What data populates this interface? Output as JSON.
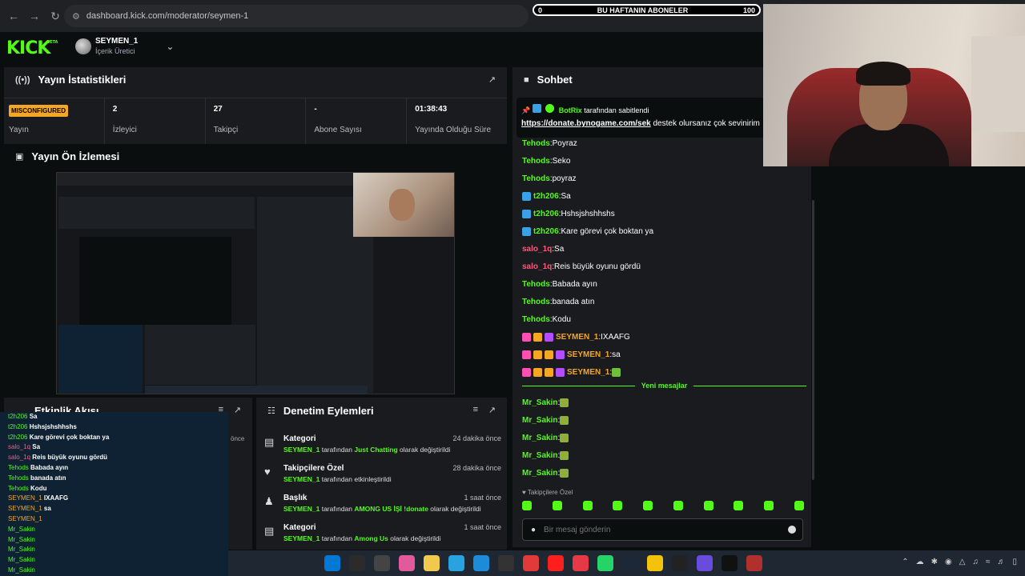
{
  "browser": {
    "url": "dashboard.kick.com/moderator/seymen-1",
    "back_icon": "arrow-left",
    "forward_icon": "arrow-right",
    "reload_icon": "reload"
  },
  "sub_goal": {
    "left": "0",
    "title": "BU HAFTANIN ABONELER",
    "right": "100",
    "progress": 0
  },
  "header": {
    "logo": "KICK",
    "logo_badge": "BETA",
    "user_name": "SEYMEN_1",
    "user_role": "İçerik Üretici"
  },
  "stats": {
    "title": "Yayın İstatistikleri",
    "items": [
      {
        "value": "MISCONFIGURED",
        "label": "Yayın"
      },
      {
        "value": "2",
        "label": "İzleyici"
      },
      {
        "value": "27",
        "label": "Takipçi"
      },
      {
        "value": "-",
        "label": "Abone Sayısı"
      },
      {
        "value": "01:38:43",
        "label": "Yayında Olduğu Süre"
      }
    ]
  },
  "preview": {
    "title": "Yayın Ön İzlemesi"
  },
  "activity": {
    "title": "Etkinlik Akışı",
    "side_text": "önce",
    "lines": [
      {
        "user": "t2h206",
        "text": "Sa",
        "color": "#53fc18"
      },
      {
        "user": "t2h206",
        "text": "Hshsjshshhshs",
        "color": "#53fc18"
      },
      {
        "user": "t2h206",
        "text": "Kare görevi çok boktan ya",
        "color": "#53fc18"
      },
      {
        "user": "salo_1q",
        "text": "Sa",
        "color": "#ff5a7a"
      },
      {
        "user": "salo_1q",
        "text": "Reis büyük oyunu gördü",
        "color": "#ff5a7a"
      },
      {
        "user": "Tehods",
        "text": "Babada ayın",
        "color": "#53fc18"
      },
      {
        "user": "Tehods",
        "text": "banada atın",
        "color": "#53fc18"
      },
      {
        "user": "Tehods",
        "text": "Kodu",
        "color": "#53fc18"
      },
      {
        "user": "SEYMEN_1",
        "text": "IXAAFG",
        "color": "#f5a623"
      },
      {
        "user": "SEYMEN_1",
        "text": "sa",
        "color": "#f5a623"
      },
      {
        "user": "SEYMEN_1",
        "text": "",
        "color": "#f5a623"
      },
      {
        "user": "Mr_Sakin",
        "text": "",
        "color": "#53fc18"
      },
      {
        "user": "Mr_Sakin",
        "text": "",
        "color": "#53fc18"
      },
      {
        "user": "Mr_Sakin",
        "text": "",
        "color": "#53fc18"
      },
      {
        "user": "Mr_Sakin",
        "text": "",
        "color": "#53fc18"
      },
      {
        "user": "Mr_Sakin",
        "text": "",
        "color": "#53fc18"
      }
    ]
  },
  "audit": {
    "title": "Denetim Eylemleri",
    "items": [
      {
        "title": "Kategori",
        "time": "24 dakika önce",
        "user": "SEYMEN_1",
        "pre": " tarafından ",
        "highlight": "Just Chatting",
        "post": " olarak değiştirildi"
      },
      {
        "title": "Takipçilere Özel",
        "time": "28 dakika önce",
        "user": "SEYMEN_1",
        "pre": " tarafından etkinleştirildi",
        "highlight": "",
        "post": ""
      },
      {
        "title": "Başlık",
        "time": "1 saat önce",
        "user": "SEYMEN_1",
        "pre": " tarafından ",
        "highlight": "AMONG US İŞİ !donate",
        "post": " olarak değiştirildi"
      },
      {
        "title": "Kategori",
        "time": "1 saat önce",
        "user": "SEYMEN_1",
        "pre": " tarafından ",
        "highlight": "Among Us",
        "post": " olarak değiştirildi"
      }
    ]
  },
  "chat": {
    "title": "Sohbet",
    "pinned": {
      "user": "BotRix",
      "suffix": "tarafından sabitlendi",
      "link": "https://donate.bynogame.com/sek",
      "text": " destek olursanız çok sevinirim"
    },
    "messages": [
      {
        "user": "Tehods",
        "text": "Poyraz",
        "color": "#53fc18",
        "badges": []
      },
      {
        "user": "Tehods",
        "text": "Seko",
        "color": "#53fc18",
        "badges": []
      },
      {
        "user": "Tehods",
        "text": "poyraz",
        "color": "#53fc18",
        "badges": []
      },
      {
        "user": "t2h206",
        "text": "Sa",
        "color": "#53fc18",
        "badges": [
          "#3aa0e8"
        ]
      },
      {
        "user": "t2h206",
        "text": "Hshsjshshhshs",
        "color": "#53fc18",
        "badges": [
          "#3aa0e8"
        ]
      },
      {
        "user": "t2h206",
        "text": "Kare görevi çok boktan ya",
        "color": "#53fc18",
        "badges": [
          "#3aa0e8"
        ]
      },
      {
        "user": "salo_1q",
        "text": "Sa",
        "color": "#ff5a7a",
        "badges": []
      },
      {
        "user": "salo_1q",
        "text": "Reis büyük oyunu gördü",
        "color": "#ff5a7a",
        "badges": []
      },
      {
        "user": "Tehods",
        "text": "Babada ayın",
        "color": "#53fc18",
        "badges": []
      },
      {
        "user": "Tehods",
        "text": "banada atın",
        "color": "#53fc18",
        "badges": []
      },
      {
        "user": "Tehods",
        "text": "Kodu",
        "color": "#53fc18",
        "badges": []
      },
      {
        "user": "SEYMEN_1",
        "text": "IXAAFG",
        "color": "#f5a623",
        "badges": [
          "#ff4fb2",
          "#f5a623",
          "#b44cff"
        ]
      },
      {
        "user": "SEYMEN_1",
        "text": "sa",
        "color": "#f5a623",
        "badges": [
          "#ff4fb2",
          "#f5a623",
          "#f5a623",
          "#b44cff"
        ]
      },
      {
        "user": "SEYMEN_1",
        "text": "",
        "color": "#f5a623",
        "badges": [
          "#ff4fb2",
          "#f5a623",
          "#f5a623",
          "#b44cff"
        ]
      }
    ],
    "new_messages_label": "Yeni mesajlar",
    "after": [
      {
        "user": "Mr_Sakin",
        "text": "",
        "color": "#53fc18"
      },
      {
        "user": "Mr_Sakin",
        "text": "",
        "color": "#53fc18"
      },
      {
        "user": "Mr_Sakin",
        "text": "",
        "color": "#53fc18"
      },
      {
        "user": "Mr_Sakin",
        "text": "",
        "color": "#53fc18"
      },
      {
        "user": "Mr_Sakin",
        "text": "",
        "color": "#53fc18"
      }
    ],
    "followers_only": "Takipçilere Özel",
    "input_placeholder": "Bir mesaj gönderin"
  },
  "taskbar": {
    "app_colors": [
      "#0078d4",
      "#2b2b2b",
      "#444",
      "#e05a9c",
      "#f2c94c",
      "#29a3df",
      "#1c8bd9",
      "#333",
      "#e03a3a",
      "#ff1e1e",
      "#e63946",
      "#25d366",
      "#1b2838",
      "#f4c20d",
      "#222",
      "#6a4bdc",
      "#111",
      "#b0302c"
    ],
    "tray_icons": [
      "up-icon",
      "cloud-icon",
      "bluetooth-icon",
      "steam-icon",
      "shield-icon",
      "mic-icon",
      "wifi-icon",
      "speaker-icon",
      "battery-icon"
    ]
  }
}
